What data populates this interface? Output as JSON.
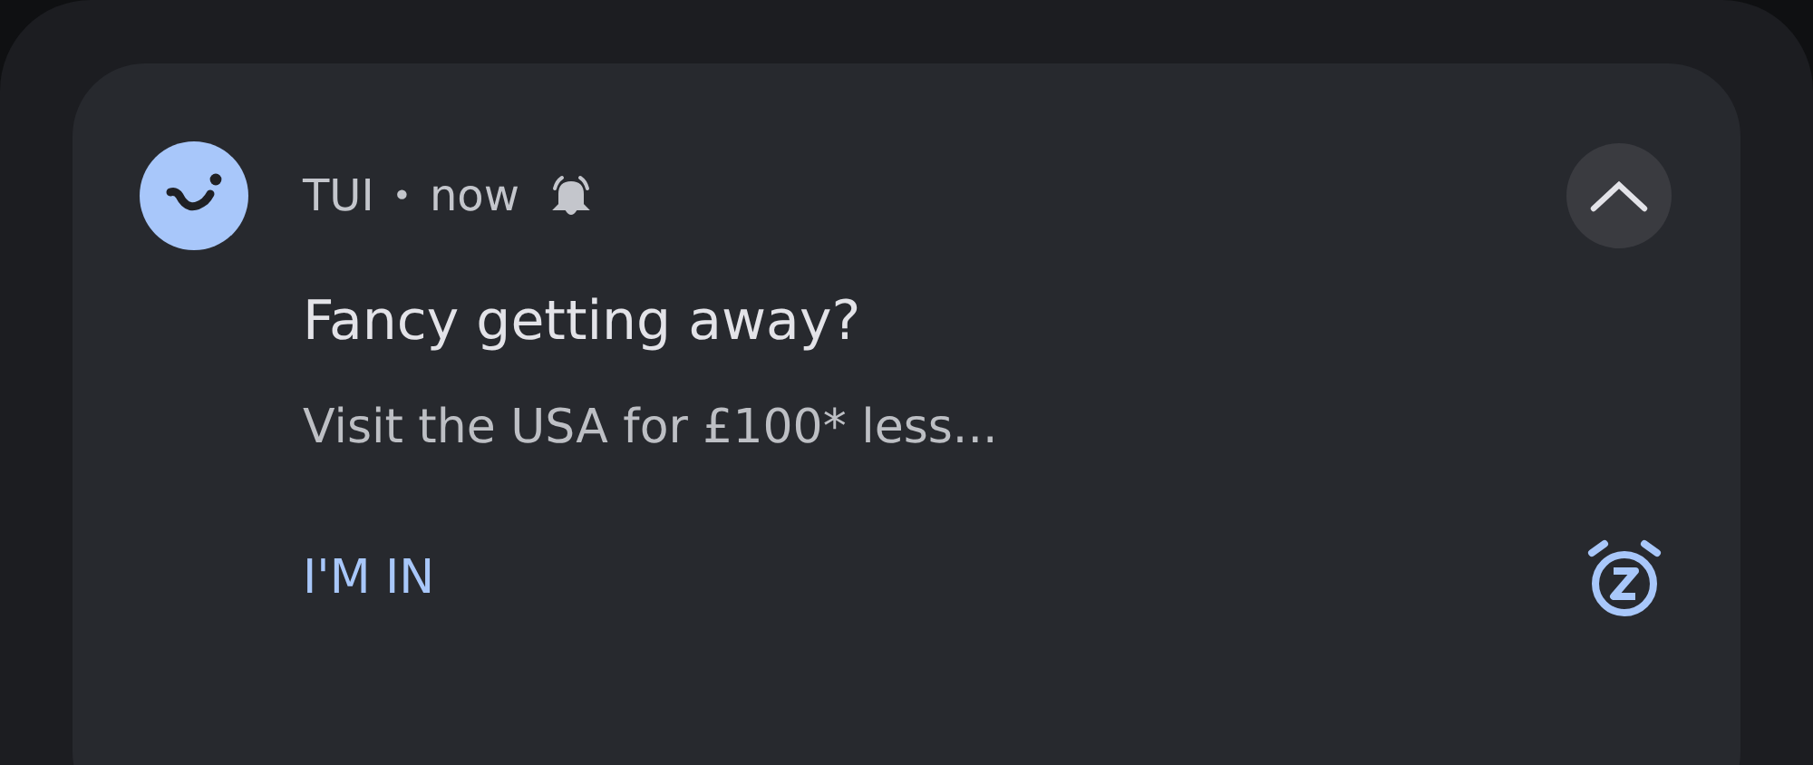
{
  "notification": {
    "app": "TUI",
    "separator": "•",
    "time": "now",
    "expanded": true,
    "title": "Fancy getting away?",
    "body": "Visit the USA for £100* less...",
    "actions": [
      {
        "label": "I'M IN"
      }
    ]
  }
}
